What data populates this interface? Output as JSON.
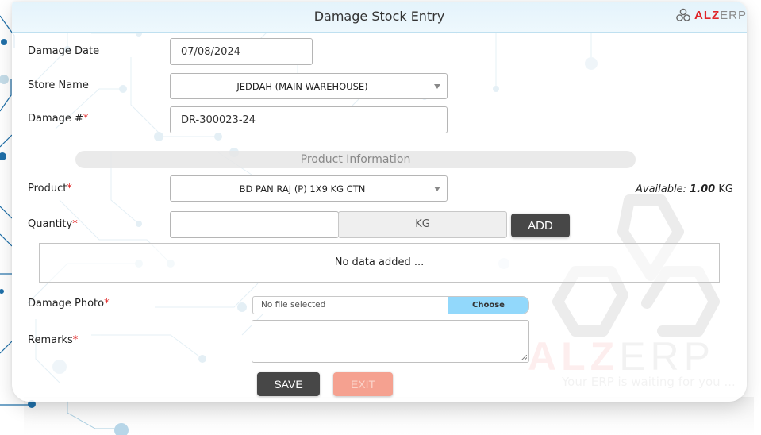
{
  "header": {
    "title": "Damage Stock Entry",
    "logo": {
      "alz": "ALZ",
      "erp": "ERP",
      "icon": "hexagon-links-logo"
    }
  },
  "form": {
    "damage_date": {
      "label": "Damage Date",
      "value": "07/08/2024",
      "required": false
    },
    "store_name": {
      "label": "Store Name",
      "value": "JEDDAH (MAIN WAREHOUSE)",
      "required": false
    },
    "damage_no": {
      "label": "Damage #",
      "value": "DR-300023-24",
      "required": true
    },
    "section_title": "Product Information",
    "product": {
      "label": "Product",
      "value": "BD PAN RAJ (P) 1X9 KG CTN",
      "required": true
    },
    "available": {
      "label": "Available:",
      "value": "1.00",
      "unit": "KG"
    },
    "quantity": {
      "label": "Quantity",
      "value": "",
      "unit": "KG",
      "required": true
    },
    "add_button": "ADD",
    "table_empty_text": "No data added ...",
    "damage_photo": {
      "label": "Damage Photo",
      "file_text": "No file selected",
      "choose_label": "Choose",
      "required": true
    },
    "remarks": {
      "label": "Remarks",
      "value": "",
      "required": true
    },
    "required_marker": "*",
    "save_button": "SAVE",
    "exit_button": "EXIT"
  },
  "watermark": {
    "alz": "ALZ",
    "erp": "ERP",
    "tagline": "Your ERP is waiting for you ..."
  },
  "colors": {
    "accent_red": "#e0262b",
    "header_bg": "#e4f3fb",
    "button_dark": "#474747",
    "button_exit": "#f5a190",
    "choose_button": "#92d8fb",
    "required": "#e02020"
  }
}
